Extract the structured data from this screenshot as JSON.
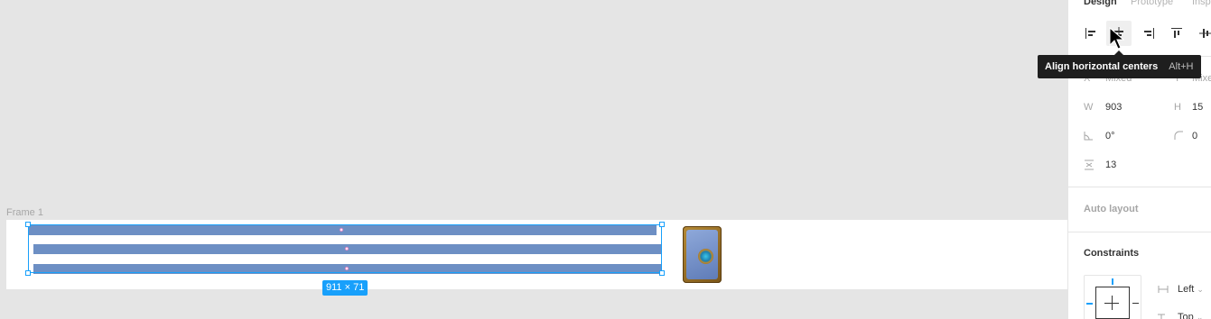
{
  "canvas": {
    "frame_label": "Frame 1",
    "selection_size": "911 × 71",
    "card_icon": "hearthstone-card-back-image"
  },
  "panel": {
    "tabs": [
      {
        "label": "Design",
        "active": true
      },
      {
        "label": "Prototype",
        "active": false
      },
      {
        "label": "Insp",
        "active": false
      }
    ],
    "align_buttons": [
      {
        "name": "align-left-icon"
      },
      {
        "name": "align-horizontal-centers-icon"
      },
      {
        "name": "align-right-icon"
      },
      {
        "name": "align-top-icon"
      },
      {
        "name": "align-vertical-centers-icon"
      }
    ],
    "tooltip": {
      "text": "Align horizontal centers",
      "shortcut": "Alt+H"
    },
    "x": {
      "label": "X",
      "value": "Mixed"
    },
    "y": {
      "label": "Y",
      "value": "Mixed"
    },
    "w": {
      "label": "W",
      "value": "903"
    },
    "h": {
      "label": "H",
      "value": "15"
    },
    "rotation": {
      "icon": "rotation-icon",
      "value": "0°"
    },
    "radius": {
      "icon": "corner-radius-icon",
      "value": "0"
    },
    "spacing": {
      "icon": "spacing-icon",
      "value": "13"
    },
    "auto_layout": "Auto layout",
    "constraints": {
      "title": "Constraints",
      "horizontal": "Left",
      "vertical": "Top"
    }
  },
  "colors": {
    "selection": "#18a0fb",
    "bar_fill": "#6d8fc4",
    "canvas_bg": "#e5e5e5"
  }
}
